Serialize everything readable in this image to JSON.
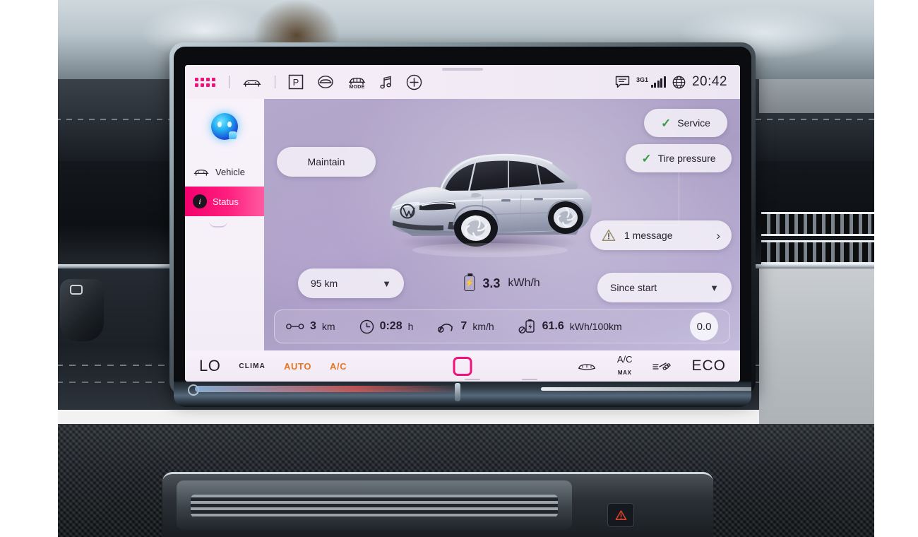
{
  "statusbar": {
    "apps_icon": "grid-apps-icon",
    "icons": [
      "car-front-icon",
      "parking-p-icon",
      "car-assist-icon",
      "drive-mode-icon",
      "music-note-icon",
      "plus-circle-icon"
    ],
    "mode_label": "MODE",
    "parking_label": "P",
    "message_icon": "message-icon",
    "network_label": "3G1",
    "globe_icon": "globe-icon",
    "time": "20:42"
  },
  "sidebar": {
    "logo": "assistant-logo-icon",
    "items": [
      {
        "label": "Vehicle",
        "icon": "car-outline-icon",
        "active": false
      },
      {
        "label": "Status",
        "icon": "info-circle-icon",
        "active": true
      }
    ]
  },
  "main": {
    "maintain_button": "Maintain",
    "service_button": "Service",
    "tire_pressure_button": "Tire pressure",
    "message_button": "1 message",
    "range_dropdown": "95 km",
    "period_dropdown": "Since start",
    "energy": {
      "value": "3.3",
      "unit": "kWh/h",
      "icon": "battery-icon"
    },
    "stats": [
      {
        "icon": "distance-icon",
        "value": "3",
        "unit": "km"
      },
      {
        "icon": "clock-icon",
        "value": "0:28",
        "unit": "h"
      },
      {
        "icon": "speedometer-icon",
        "value": "7",
        "unit": "km/h"
      },
      {
        "icon": "consumption-icon",
        "value": "61.6",
        "unit": "kWh/100km"
      }
    ],
    "stats_end_value": "0.0",
    "vehicle_image": "vw-id7-sedan-silver"
  },
  "climate": {
    "left_temp": "LO",
    "clima_label": "CLIMA",
    "auto_label": "AUTO",
    "ac_label": "A/C",
    "center_button": "square-stop-icon",
    "defrost_icon": "rear-defrost-icon",
    "ac_max_top": "A/C",
    "ac_max_bottom": "MAX",
    "fan_icon": "fan-icon",
    "eco_label": "ECO"
  },
  "colors": {
    "accent_pink": "#f0117a",
    "accent_orange": "#e8761f",
    "check_green": "#3c9c46",
    "screen_bg": "#b0a4c8"
  }
}
